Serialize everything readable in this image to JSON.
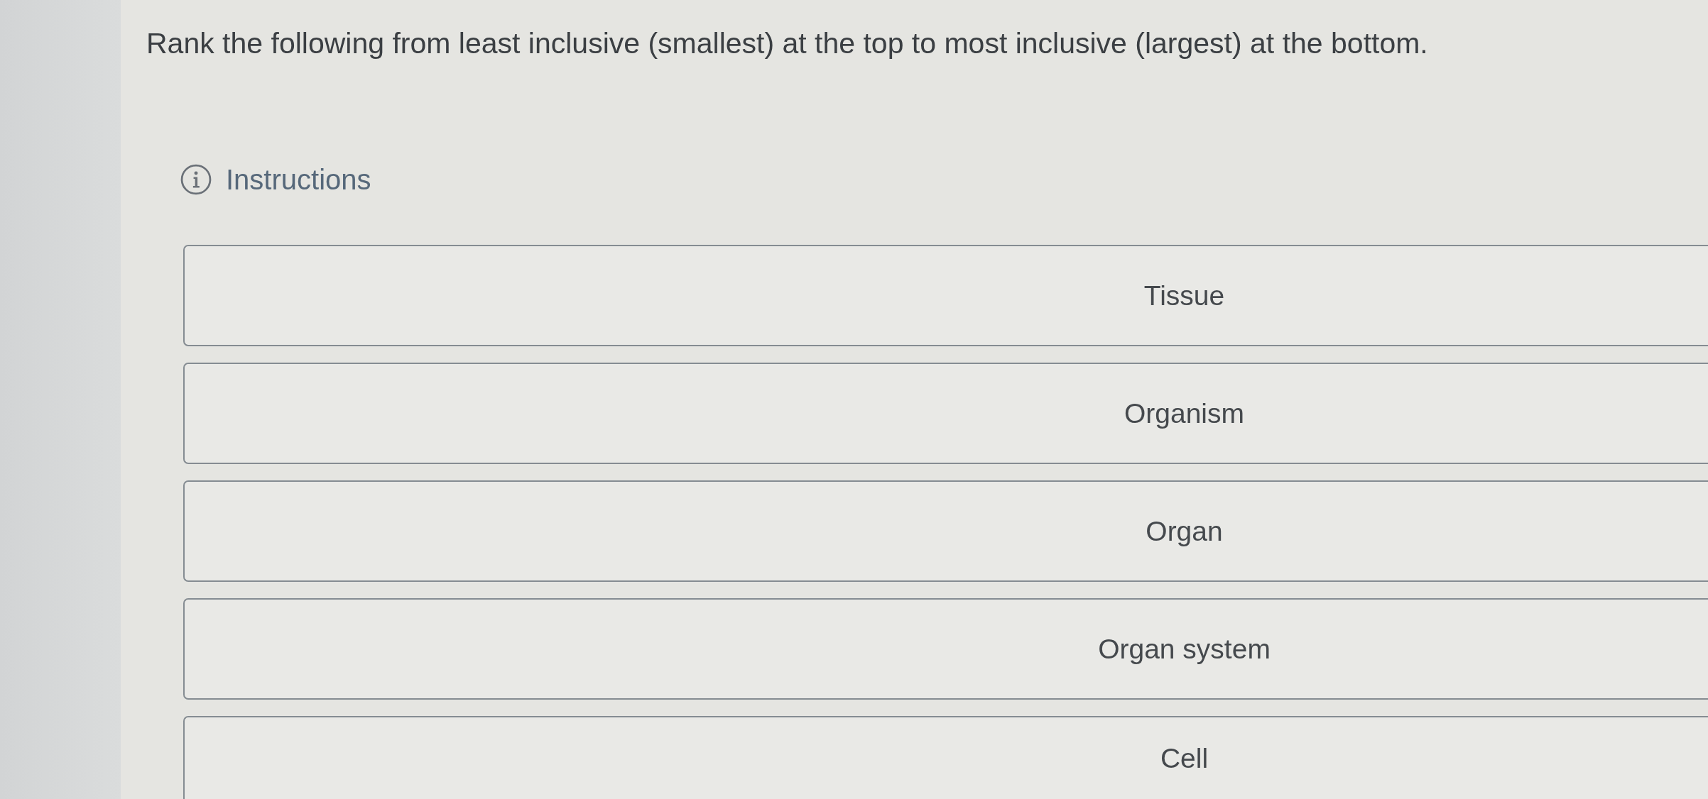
{
  "prompt": "Rank the following from least inclusive (smallest) at the top to most inclusive (largest) at the bottom.",
  "instructions": {
    "label": "Instructions"
  },
  "items": [
    {
      "label": "Tissue"
    },
    {
      "label": "Organism"
    },
    {
      "label": "Organ"
    },
    {
      "label": "Organ system"
    },
    {
      "label": "Cell"
    }
  ]
}
